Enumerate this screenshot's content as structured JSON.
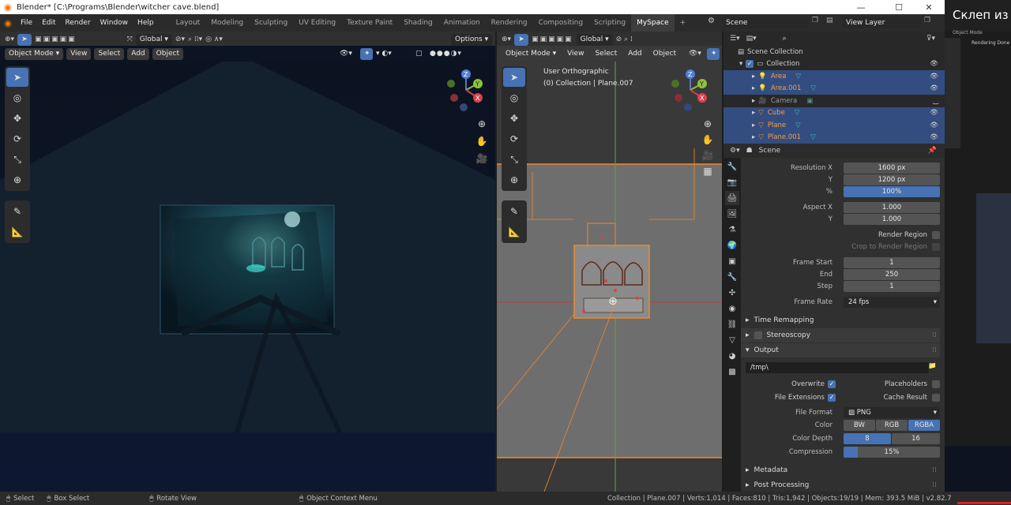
{
  "titlebar": {
    "title": "Blender* [C:\\Programs\\Blender\\witcher cave.blend]",
    "minimize": "—",
    "maximize": "☐",
    "close": "✕"
  },
  "menus": [
    "File",
    "Edit",
    "Render",
    "Window",
    "Help"
  ],
  "workspaces": [
    "Layout",
    "Modeling",
    "Sculpting",
    "UV Editing",
    "Texture Paint",
    "Shading",
    "Animation",
    "Rendering",
    "Compositing",
    "Scripting",
    "MySpace"
  ],
  "workspace_add": "+",
  "scene": {
    "label": "Scene",
    "view_layer": "View Layer"
  },
  "header": {
    "transform": "Global",
    "options": "Options"
  },
  "vp1": {
    "mode": "Object Mode",
    "menus": [
      "View",
      "Select",
      "Add",
      "Object"
    ]
  },
  "vp2": {
    "mode": "Object Mode",
    "menus": [
      "View",
      "Select",
      "Add",
      "Object"
    ],
    "overlay_title": "User Orthographic",
    "overlay_sub": "(0) Collection | Plane.007"
  },
  "gizmo": {
    "x": "X",
    "y": "Y",
    "z": "Z"
  },
  "outliner": {
    "root": "Scene Collection",
    "collection": "Collection",
    "items": [
      {
        "name": "Area",
        "selected": true
      },
      {
        "name": "Area.001",
        "selected": true
      },
      {
        "name": "Camera",
        "selected": false
      },
      {
        "name": "Cube",
        "selected": true
      },
      {
        "name": "Plane",
        "selected": true
      },
      {
        "name": "Plane.001",
        "selected": true
      }
    ]
  },
  "props": {
    "context": "Scene",
    "resolution_x_label": "Resolution X",
    "resolution_x": "1600 px",
    "y_label": "Y",
    "resolution_y": "1200 px",
    "percent_label": "%",
    "percent": "100%",
    "aspect_x_label": "Aspect X",
    "aspect_x": "1.000",
    "aspect_y_label": "Y",
    "aspect_y": "1.000",
    "render_region": "Render Region",
    "crop": "Crop to Render Region",
    "frame_start_label": "Frame Start",
    "frame_start": "1",
    "end_label": "End",
    "frame_end": "250",
    "step_label": "Step",
    "frame_step": "1",
    "frame_rate_label": "Frame Rate",
    "frame_rate": "24 fps",
    "time_remapping": "Time Remapping",
    "stereoscopy": "Stereoscopy",
    "output": "Output",
    "output_path": "/tmp\\",
    "overwrite": "Overwrite",
    "placeholders": "Placeholders",
    "file_extensions": "File Extensions",
    "cache_result": "Cache Result",
    "file_format_label": "File Format",
    "file_format": "PNG",
    "color_label": "Color",
    "color_bw": "BW",
    "color_rgb": "RGB",
    "color_rgba": "RGBA",
    "color_depth_label": "Color Depth",
    "depth_8": "8",
    "depth_16": "16",
    "compression_label": "Compression",
    "compression": "15%",
    "compression_value": 0.15,
    "metadata": "Metadata",
    "post_processing": "Post Processing"
  },
  "status": {
    "select": "Select",
    "box_select": "Box Select",
    "rotate_view": "Rotate View",
    "context_menu": "Object Context Menu",
    "info": "Collection | Plane.007 | Verts:1,014 | Faces:810 | Tris:1,942 | Objects:19/19 | Mem: 393.5 MiB | v2.82.7"
  },
  "rightwin": {
    "title": "Склеп из",
    "sub": "Rendering Done",
    "mode": "Object Mode"
  },
  "colors": {
    "accent": "#4772b3",
    "selected_row": "#334d80",
    "orange": "#f08a28",
    "teal": "#2fc8c0"
  }
}
